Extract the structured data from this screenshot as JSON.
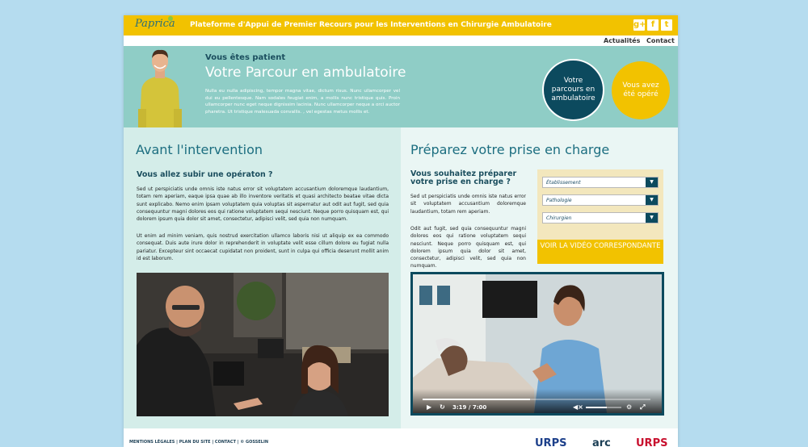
{
  "brand": {
    "logo": "Paprica",
    "accent": "#f2c200",
    "dark": "#0c4a5e",
    "teal": "#8fcdc6"
  },
  "topbar": {
    "title": "Plateforme d'Appui de Premier Recours pour les Interventions en Chirurgie Ambulatoire"
  },
  "social": {
    "items": [
      {
        "icon": "google-plus-icon",
        "glyph": "g+"
      },
      {
        "icon": "facebook-icon",
        "glyph": "f"
      },
      {
        "icon": "twitter-icon",
        "glyph": "t"
      }
    ]
  },
  "nav": {
    "items": [
      "Actualités",
      "Contact"
    ]
  },
  "hero": {
    "kicker": "Vous êtes patient",
    "title": "Votre Parcour en ambulatoire",
    "text": "Nulla eu nulla adipiscing, tempor magna vitae, dictum risus. Nunc ullamcorper vel dui eu pellentesque. Nam sodales feugiat enim, a mollis nunc tristique quis. Proin ullamcorper nunc eget neque dignissim lacinia. Nunc ullamcorper neque a orci auctor pharetra. Ut tristique malesuada convallis. , vel egestas metus mollis et.",
    "circle_primary": "Votre parcours en ambulatoire",
    "circle_secondary": "Vous avez été opéré"
  },
  "left": {
    "title": "Avant l'intervention",
    "subtitle": "Vous allez subir une opératon ?",
    "para1": "Sed ut perspiciatis unde omnis iste natus error sit voluptatem accusantium doloremque laudantium, totam rem aperiam, eaque ipsa quae ab illo inventore veritatis et quasi architecto beatae vitae dicta sunt explicabo. Nemo enim ipsam voluptatem quia voluptas sit aspernatur aut odit aut fugit, sed quia consequuntur magni dolores eos qui ratione voluptatem sequi nesciunt. Neque porro quisquam est, qui dolorem ipsum quia dolor sit amet, consectetur, adipisci velit, sed quia non numquam.",
    "para2": "Ut enim ad minim veniam, quis nostrud exercitation ullamco laboris nisi ut aliquip ex ea commodo consequat. Duis aute irure dolor in reprehenderit in voluptate velit esse cillum dolore eu fugiat nulla pariatur. Excepteur sint occaecat cupidatat non proident, sunt in culpa qui officia deserunt mollit anim id est laborum."
  },
  "right": {
    "title": "Préparez votre prise en charge",
    "subtitle": "Vous souhaitez préparer votre prise en charge ?",
    "para1": "Sed ut perspiciatis unde omnis iste natus error sit voluptatem accusantium doloremque laudantium, totam rem aperiam.",
    "para2": "Odit aut fugit, sed quia consequuntur magni dolores eos qui ratione voluptatem sequi nesciunt. Neque porro quisquam est, qui dolorem ipsum quia dolor sit amet, consectetur, adipisci velit, sed quia non numquam.",
    "selects": [
      "Établissement",
      "Pathologie",
      "Chirurgien"
    ],
    "cta": "VOIR LA VIDÉO CORRESPONDANTE",
    "video": {
      "time": "3:19 / 7:00",
      "progress": 0.47,
      "volume": 0.6
    }
  },
  "footer": {
    "links": "MENTIONS LÉGALES   |   PLAN DU SITE   |   CONTACT   |   © GOSSELIN"
  },
  "partners": {
    "items": [
      "URPS",
      "arc",
      "URPS mb"
    ]
  }
}
